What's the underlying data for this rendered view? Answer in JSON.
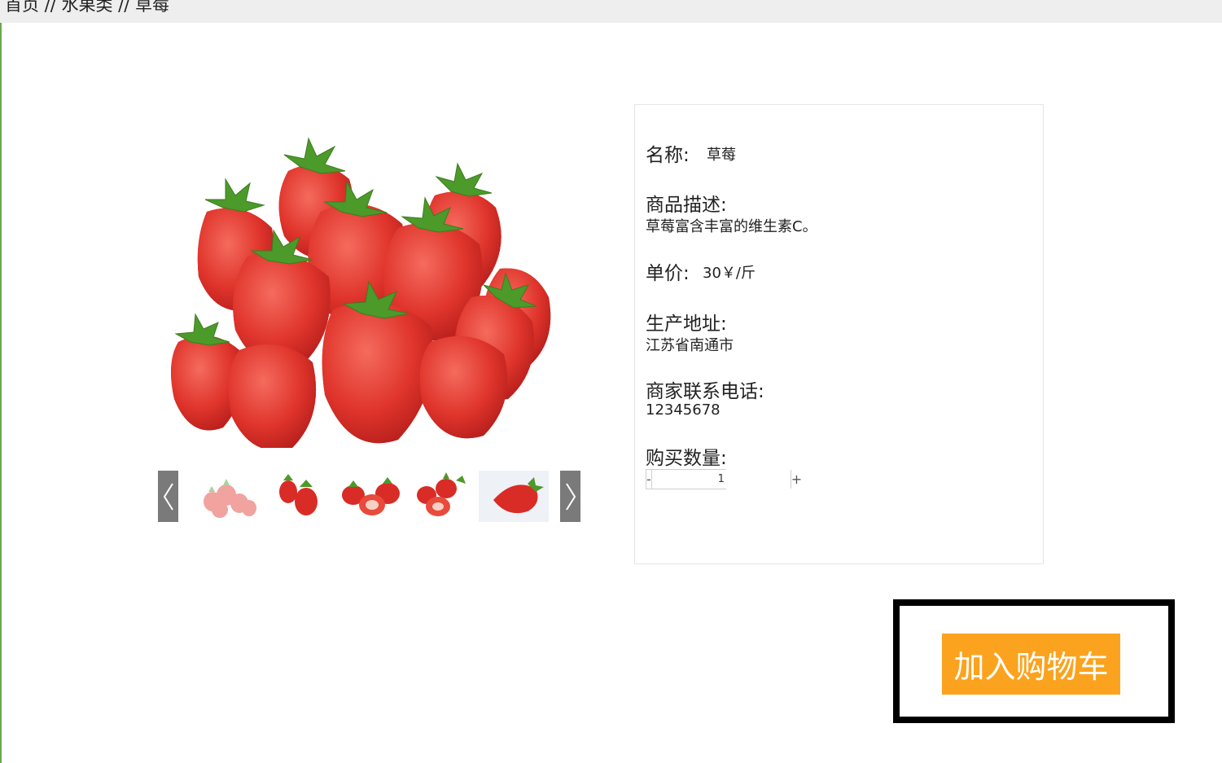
{
  "breadcrumb": {
    "text": "首页 // 水果类 // 草莓"
  },
  "gallery": {
    "main_image_alt": "strawberries",
    "thumbnails": [
      "thumbnail-1",
      "thumbnail-2",
      "thumbnail-3",
      "thumbnail-4",
      "thumbnail-5"
    ]
  },
  "product": {
    "name_label": "名称:",
    "name_value": "草莓",
    "desc_label": "商品描述:",
    "desc_value": "草莓富含丰富的维生素C。",
    "price_label": "单价:",
    "price_value": "30￥/斤",
    "origin_label": "生产地址:",
    "origin_value": "江苏省南通市",
    "phone_label": "商家联系电话:",
    "phone_value": "12345678",
    "qty_label": "购买数量:",
    "qty_value": "1",
    "qty_minus": "-",
    "qty_plus": "+"
  },
  "cart": {
    "button_label": "加入购物车"
  },
  "colors": {
    "accent": "#fba31e",
    "arrow_bg": "#7a7a7a",
    "breadcrumb_bg": "#eeeeee"
  }
}
